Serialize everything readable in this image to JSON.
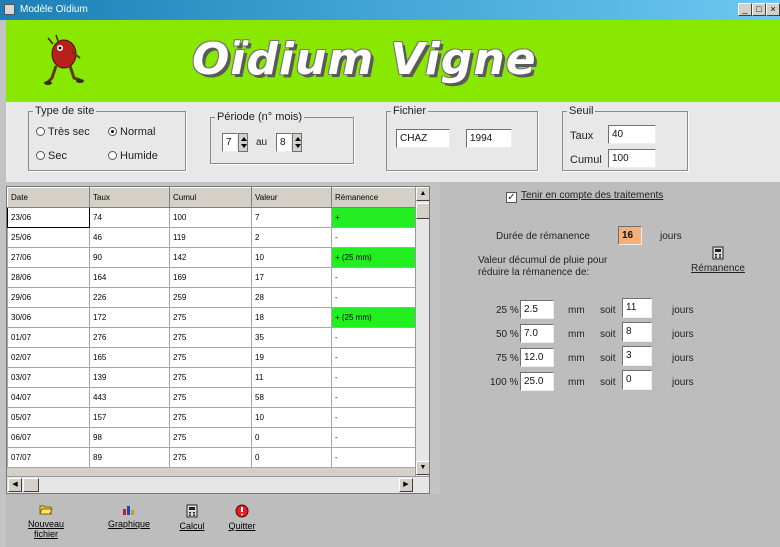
{
  "window": {
    "title": "Modèle Oïdium",
    "buttons": {
      "minimize": "_",
      "maximize": "□",
      "close": "×"
    }
  },
  "banner": {
    "title": "Oïdium Vigne",
    "mascot_icon": "running-mascot-icon"
  },
  "site_type": {
    "legend": "Type de site",
    "options": [
      {
        "label": "Très sec",
        "selected": false
      },
      {
        "label": "Normal",
        "selected": true
      },
      {
        "label": "Sec",
        "selected": false
      },
      {
        "label": "Humide",
        "selected": false
      }
    ]
  },
  "period": {
    "legend": "Période (n° mois)",
    "from": "7",
    "to_label": "au",
    "to": "8"
  },
  "file": {
    "legend": "Fichier",
    "name": "CHAZ",
    "year": "1994"
  },
  "threshold": {
    "legend": "Seuil",
    "rate_label": "Taux",
    "rate_value": "40",
    "cumul_label": "Cumul",
    "cumul_value": "100"
  },
  "table": {
    "headers": [
      "Date",
      "Taux",
      "Cumul",
      "Valeur",
      "Rémanence"
    ],
    "rows": [
      {
        "date": "23/06",
        "taux": "74",
        "cumul": "100",
        "valeur": "7",
        "remanence": "+",
        "highlight": true
      },
      {
        "date": "25/06",
        "taux": "46",
        "cumul": "119",
        "valeur": "2",
        "remanence": "-",
        "highlight": false
      },
      {
        "date": "27/06",
        "taux": "90",
        "cumul": "142",
        "valeur": "10",
        "remanence": "+ (25 mm)",
        "highlight": true
      },
      {
        "date": "28/06",
        "taux": "164",
        "cumul": "169",
        "valeur": "17",
        "remanence": "-",
        "highlight": false
      },
      {
        "date": "29/06",
        "taux": "226",
        "cumul": "259",
        "valeur": "28",
        "remanence": "-",
        "highlight": false
      },
      {
        "date": "30/06",
        "taux": "172",
        "cumul": "275",
        "valeur": "18",
        "remanence": "+ (25 mm)",
        "highlight": true
      },
      {
        "date": "01/07",
        "taux": "276",
        "cumul": "275",
        "valeur": "35",
        "remanence": "-",
        "highlight": false
      },
      {
        "date": "02/07",
        "taux": "165",
        "cumul": "275",
        "valeur": "19",
        "remanence": "-",
        "highlight": false
      },
      {
        "date": "03/07",
        "taux": "139",
        "cumul": "275",
        "valeur": "11",
        "remanence": "-",
        "highlight": false
      },
      {
        "date": "04/07",
        "taux": "443",
        "cumul": "275",
        "valeur": "58",
        "remanence": "-",
        "highlight": false
      },
      {
        "date": "05/07",
        "taux": "157",
        "cumul": "275",
        "valeur": "10",
        "remanence": "-",
        "highlight": false
      },
      {
        "date": "06/07",
        "taux": "98",
        "cumul": "275",
        "valeur": "0",
        "remanence": "-",
        "highlight": false
      },
      {
        "date": "07/07",
        "taux": "89",
        "cumul": "275",
        "valeur": "0",
        "remanence": "-",
        "highlight": false
      }
    ]
  },
  "remanence_panel": {
    "checkbox_label": "Tenir en compte des traitements",
    "checkbox_checked": true,
    "duration_label": "Durée de rémanence",
    "duration_value": "16",
    "duration_unit": "jours",
    "rain_text_line1": "Valeur décumul de pluie pour",
    "rain_text_line2": "réduire la rémanence de:",
    "remanence_button": "Rémanence",
    "rows": [
      {
        "pct": "25 %",
        "mm": "2.5",
        "mm_unit": "mm",
        "soit": "soit",
        "days": "11",
        "days_unit": "jours"
      },
      {
        "pct": "50 %",
        "mm": "7.0",
        "mm_unit": "mm",
        "soit": "soit",
        "days": "8",
        "days_unit": "jours"
      },
      {
        "pct": "75 %",
        "mm": "12.0",
        "mm_unit": "mm",
        "soit": "soit",
        "days": "3",
        "days_unit": "jours"
      },
      {
        "pct": "100 %",
        "mm": "25.0",
        "mm_unit": "mm",
        "soit": "soit",
        "days": "0",
        "days_unit": "jours"
      }
    ]
  },
  "toolbar": {
    "buttons": [
      {
        "label": "Nouveau fichier",
        "icon": "folder-open-icon"
      },
      {
        "label": "Graphique",
        "icon": "chart-icon"
      },
      {
        "label": "Calcul",
        "icon": "calculator-icon"
      },
      {
        "label": "Quitter",
        "icon": "quit-icon"
      }
    ]
  },
  "colors": {
    "banner": "#88e800",
    "remanence_highlight": "#22ee22",
    "duration_field": "#f5b07a"
  }
}
